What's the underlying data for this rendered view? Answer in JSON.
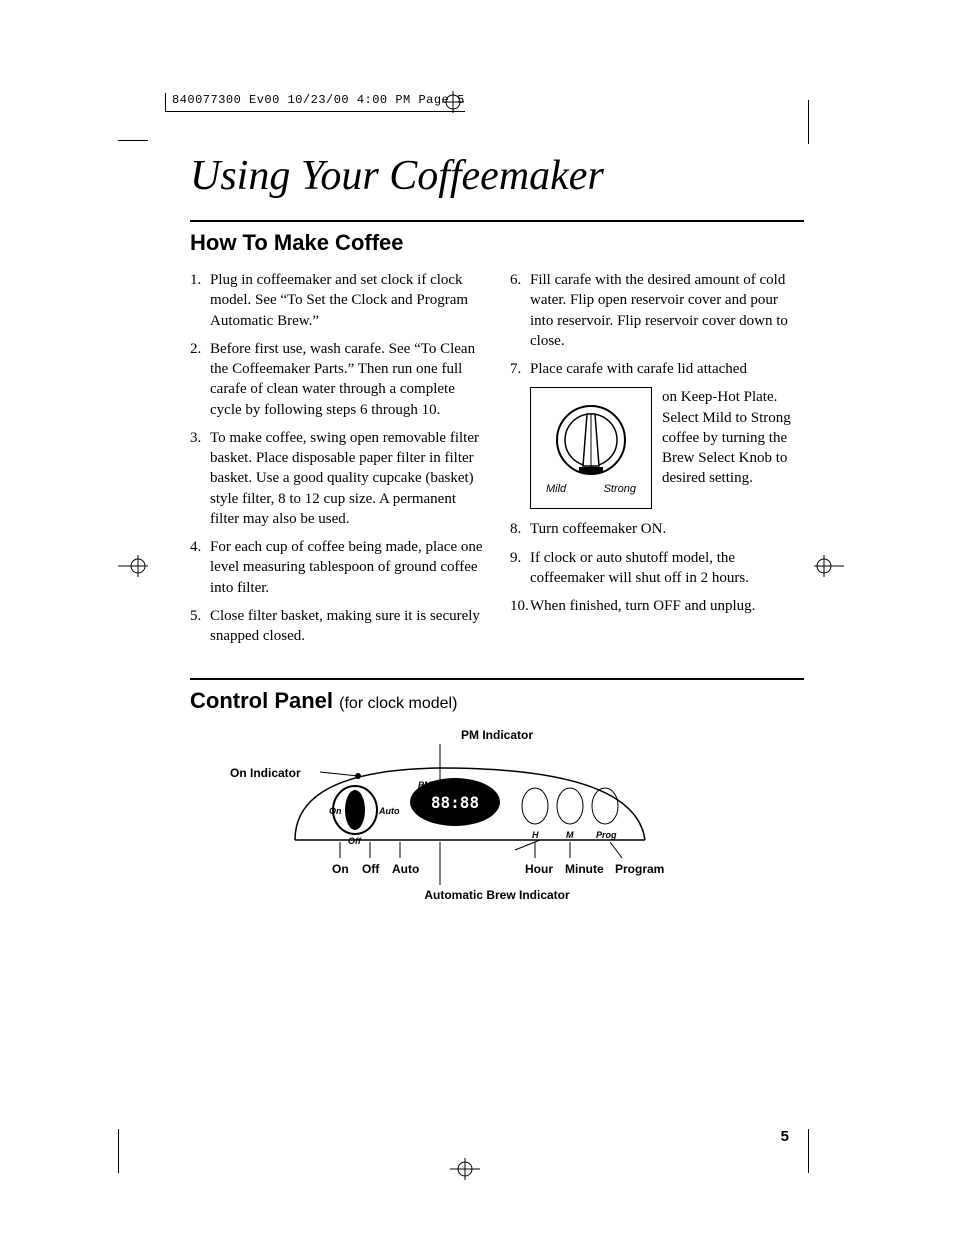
{
  "slug": "840077300 Ev00  10/23/00  4:00 PM  Page 5",
  "title": "Using Your Coffeemaker",
  "section1": {
    "heading": "How To Make Coffee",
    "left": [
      {
        "n": "1.",
        "t": "Plug in coffeemaker and set clock if clock model. See “To Set the Clock and Program Automatic Brew.”"
      },
      {
        "n": "2.",
        "t": "Before first use, wash carafe. See “To Clean the Coffeemaker Parts.” Then run one full carafe of clean water through a complete cycle by following steps 6 through 10."
      },
      {
        "n": "3.",
        "t": "To make coffee, swing open removable filter basket. Place disposable paper filter in filter basket. Use a good quality cupcake (basket) style filter, 8 to 12 cup size. A permanent filter may also be used."
      },
      {
        "n": "4.",
        "t": "For each cup of coffee being made, place one level measuring tablespoon of ground coffee into filter."
      },
      {
        "n": "5.",
        "t": "Close filter basket, making sure it is securely snapped closed."
      }
    ],
    "right_top": [
      {
        "n": "6.",
        "t": "Fill carafe with the desired amount of cold water. Flip open reservoir cover and pour into reservoir. Flip reservoir cover down to close."
      },
      {
        "n": "7.",
        "t": "Place carafe with carafe lid attached"
      }
    ],
    "knob": {
      "mild": "Mild",
      "strong": "Strong",
      "side_text": "on Keep-Hot Plate. Select Mild to Strong coffee by turning the Brew Select Knob to desired setting."
    },
    "right_bottom": [
      {
        "n": "8.",
        "t": "Turn coffeemaker ON."
      },
      {
        "n": "9.",
        "t": "If clock or auto shutoff model, the coffeemaker will shut off in 2 hours."
      },
      {
        "n": "10.",
        "t": "When finished, turn OFF and unplug."
      }
    ]
  },
  "section2": {
    "heading": "Control Panel",
    "sub": "(for clock model)",
    "labels": {
      "pm_ind": "PM Indicator",
      "on_ind": "On Indicator",
      "on": "On",
      "off": "Off",
      "auto": "Auto",
      "autobrew": "Automatic Brew Indicator",
      "hour": "Hour",
      "minute": "Minute",
      "program": "Program",
      "pm": "PM",
      "h": "H",
      "m": "M",
      "prog": "Prog",
      "display": "88:88"
    }
  },
  "page_number": "5"
}
